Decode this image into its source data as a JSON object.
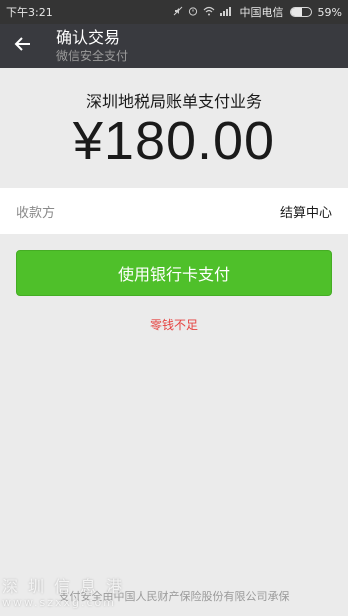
{
  "status_bar": {
    "time": "下午3:21",
    "carrier": "中国电信",
    "battery_percent": "59%",
    "battery_level": 0.59,
    "icons": [
      "mute-icon",
      "alarm-icon",
      "wifi-icon",
      "signal-icon",
      "battery-icon"
    ]
  },
  "app_bar": {
    "back_icon": "arrow-left-icon",
    "title": "确认交易",
    "subtitle": "微信安全支付"
  },
  "payment": {
    "merchant": "深圳地税局账单支付业务",
    "amount": "¥180.00"
  },
  "payee": {
    "label": "收款方",
    "value": "结算中心"
  },
  "actions": {
    "pay_button": "使用银行卡支付"
  },
  "warning_text": "零钱不足",
  "footer": {
    "insurance": "支付安全由中国人民财产保险股份有限公司承保"
  },
  "watermark": {
    "cn": "深圳信息港",
    "en": "www.szxxg.com"
  },
  "colors": {
    "app_bar": "#393a3f",
    "status_bar": "#343434",
    "background": "#ebebeb",
    "button": "#4fc02a",
    "warning": "#e64340"
  }
}
